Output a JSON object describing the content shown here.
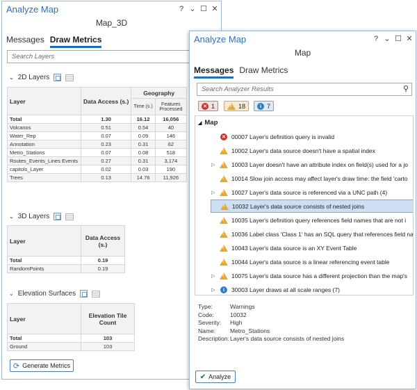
{
  "left_pane": {
    "title": "Analyze Map",
    "window_icons": [
      "?",
      "⌄",
      "☐",
      "✕"
    ],
    "map_name": "Map_3D",
    "tabs": [
      {
        "label": "Messages"
      },
      {
        "label": "Draw Metrics"
      }
    ],
    "search_placeholder": "Search Layers",
    "layers_2d": {
      "title": "2D Layers",
      "header": {
        "layer": "Layer",
        "data_access": "Data Access (s.)",
        "geography": "Geography",
        "time": "Time (s.)",
        "features": "Features Processed"
      },
      "total": {
        "label": "Total",
        "access": "1.30",
        "time": "16.12",
        "features": "16,056"
      },
      "rows": [
        {
          "name": "Volcanos",
          "access": "0.51",
          "time": "0.54",
          "features": "40"
        },
        {
          "name": "Water_Rep",
          "access": "0.07",
          "time": "0.09",
          "features": "146"
        },
        {
          "name": "Annotation",
          "access": "0.23",
          "time": "0.31",
          "features": "62"
        },
        {
          "name": "Metro_Stations",
          "access": "0.07",
          "time": "0.08",
          "features": "518"
        },
        {
          "name": "Routes_Events_Lines Events",
          "access": "0.27",
          "time": "0.31",
          "features": "3,174"
        },
        {
          "name": "capitols_Layer",
          "access": "0.02",
          "time": "0.03",
          "features": "190"
        },
        {
          "name": "Trees",
          "access": "0.13",
          "time": "14.76",
          "features": "11,926"
        }
      ]
    },
    "layers_3d": {
      "title": "3D Layers",
      "header": {
        "layer": "Layer",
        "data_access": "Data Access (s.)"
      },
      "total": {
        "label": "Total",
        "access": "0.19"
      },
      "rows": [
        {
          "name": "RandomPoints",
          "access": "0.19"
        }
      ]
    },
    "elevation": {
      "title": "Elevation Surfaces",
      "header": {
        "layer": "Layer",
        "tile_count": "Elevation Tile Count"
      },
      "total": {
        "label": "Total",
        "count": "103"
      },
      "rows": [
        {
          "name": "Ground",
          "count": "103"
        }
      ]
    },
    "generate_button": "Generate Metrics"
  },
  "right_pane": {
    "title": "Analyze Map",
    "window_icons": [
      "?",
      "⌄",
      "☐",
      "✕"
    ],
    "map_name": "Map",
    "tabs": [
      {
        "label": "Messages"
      },
      {
        "label": "Draw Metrics"
      }
    ],
    "search_placeholder": "Search Analyzer Results",
    "filters": {
      "errors": "1",
      "warnings": "18",
      "info": "7"
    },
    "tree_root": "Map",
    "messages": [
      {
        "type": "error",
        "expandable": false,
        "text": "00007 Layer's definition query is invalid"
      },
      {
        "type": "warning",
        "expandable": false,
        "text": "10002 Layer's data source doesn't have a spatial index"
      },
      {
        "type": "warning",
        "expandable": true,
        "text": "10003 Layer doesn't have an attribute index on field(s) used for a jo"
      },
      {
        "type": "warning",
        "expandable": false,
        "text": "10014 Slow join access may affect layer's draw time: the field 'carto"
      },
      {
        "type": "warning",
        "expandable": true,
        "text": "10027 Layer's data source is referenced via a UNC path (4)"
      },
      {
        "type": "warning",
        "expandable": false,
        "text": "10032 Layer's data source consists of nested joins",
        "selected": true
      },
      {
        "type": "warning",
        "expandable": false,
        "text": "10035 Layer's definition query references field names that are not i"
      },
      {
        "type": "warning",
        "expandable": false,
        "text": "10036 Label class 'Class 1' has an SQL query that references field na"
      },
      {
        "type": "warning",
        "expandable": false,
        "text": "10043 Layer's data source is an XY Event Table"
      },
      {
        "type": "warning",
        "expandable": false,
        "text": "10044 Layer's data source is a linear referencing event table"
      },
      {
        "type": "warning",
        "expandable": true,
        "text": "10075 Layer's data source has a different projection than the map's"
      },
      {
        "type": "info",
        "expandable": true,
        "text": "30003 Layer draws at all scale ranges (7)"
      }
    ],
    "details": [
      {
        "key": "Type:",
        "value": "Warnings"
      },
      {
        "key": "Code:",
        "value": "10032"
      },
      {
        "key": "Severity:",
        "value": "High"
      },
      {
        "key": "Name:",
        "value": "Metro_Stations"
      },
      {
        "key": "Description:",
        "value": "Layer's data source consists of nested joins"
      }
    ],
    "analyze_button": "Analyze"
  }
}
